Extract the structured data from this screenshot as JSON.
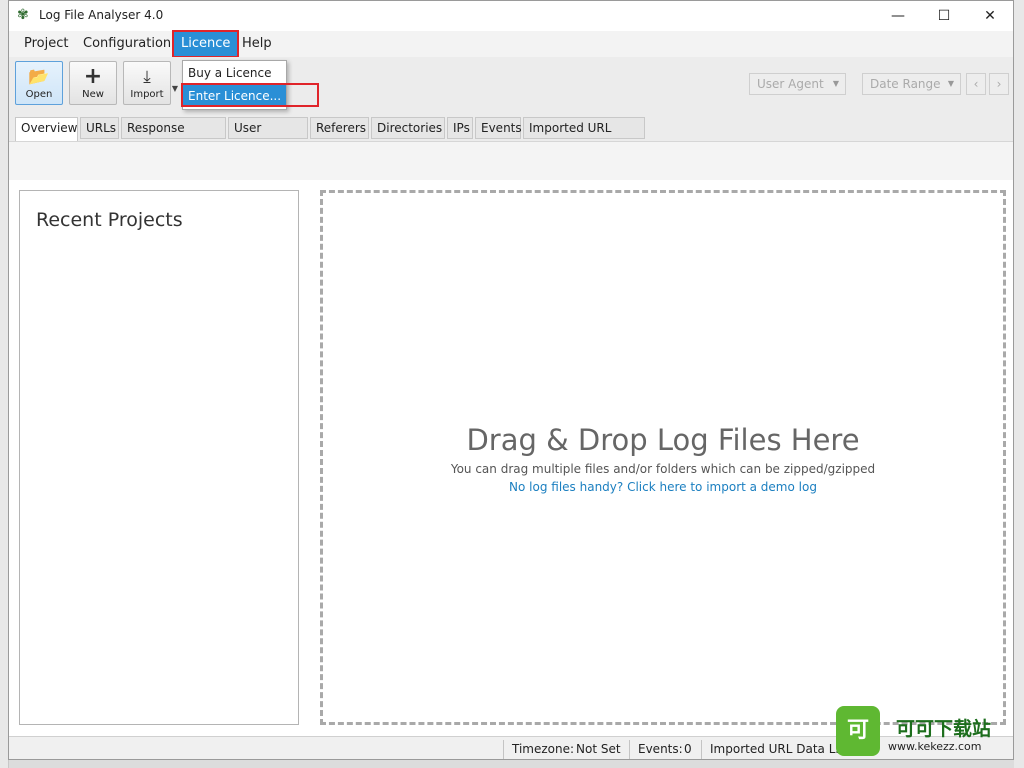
{
  "window": {
    "title": "Log File Analyser 4.0",
    "minimize": "—",
    "maximize": "☐",
    "close": "✕"
  },
  "menu": [
    "Project",
    "Configuration",
    "Licence",
    "Help"
  ],
  "licence_menu": {
    "items": [
      "Buy a Licence",
      "Enter Licence..."
    ]
  },
  "toolbar": {
    "open": "Open",
    "new": "New",
    "import": "Import",
    "user_agent": "User Agent",
    "date_range": "Date Range",
    "prev": "‹",
    "next": "›"
  },
  "tabs": [
    "Overview",
    "URLs",
    "Response Codes",
    "User Agents",
    "Referers",
    "Directories",
    "IPs",
    "Events",
    "Imported URL Data"
  ],
  "recent": {
    "title": "Recent Projects"
  },
  "drop": {
    "title": "Drag & Drop Log Files Here",
    "subtitle": "You can drag multiple files and/or folders which can be zipped/gzipped",
    "link": "No log files handy? Click here to import a demo log"
  },
  "status": {
    "timezone_label": "Timezone:",
    "timezone_value": "Not Set",
    "events_label": "Events:",
    "events_value": "0",
    "imported_label": "Imported URL Data Li"
  },
  "watermark": {
    "badge": "可",
    "text": "可可下载站",
    "url": "www.kekezz.com"
  },
  "colors": {
    "accent": "#2a8fd6",
    "highlight_box": "#e0242a",
    "link": "#1b7fc0"
  }
}
